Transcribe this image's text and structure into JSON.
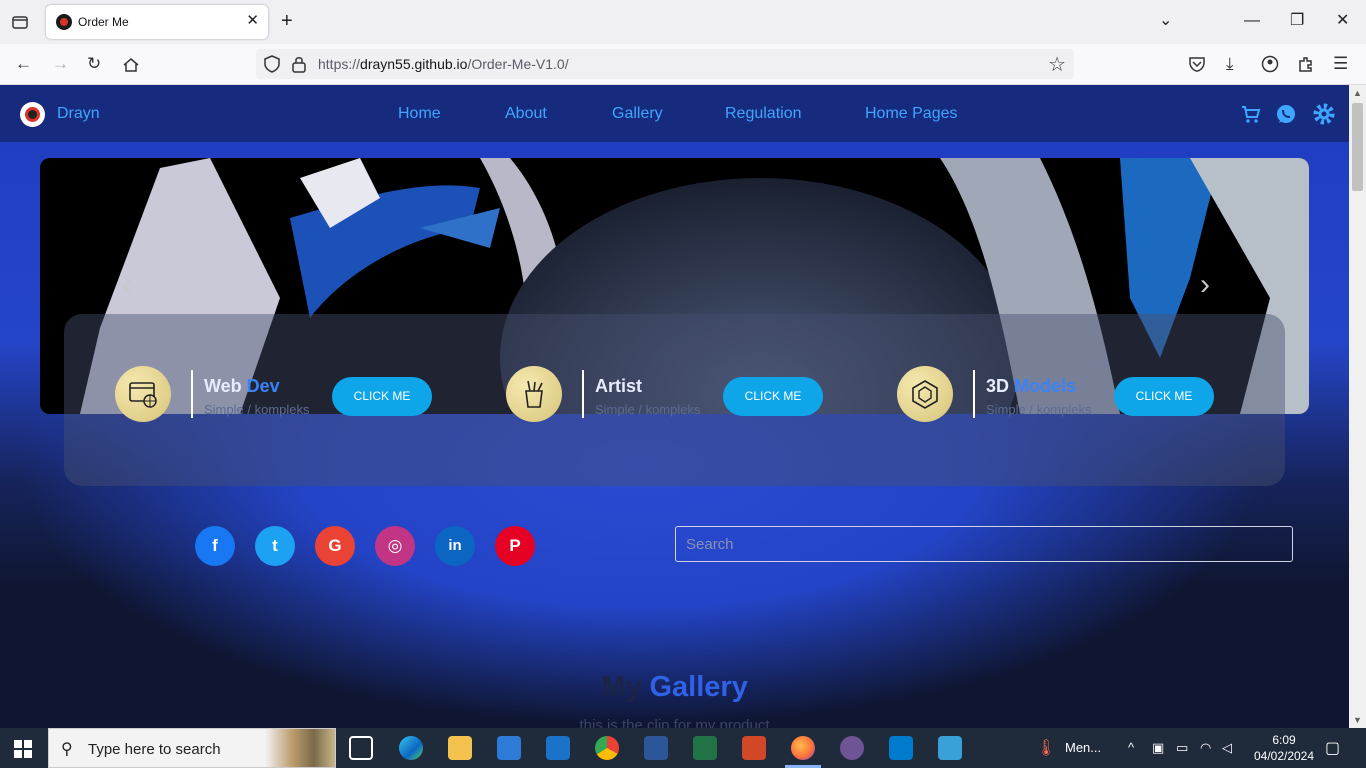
{
  "browser": {
    "tab_title": "Order Me",
    "url_prefix": "https://",
    "url_host": "drayn55.github.io",
    "url_path": "/Order-Me-V1.0/"
  },
  "site": {
    "brand": "Drayn",
    "menu": [
      "Home",
      "About",
      "Gallery",
      "Regulation",
      "Home Pages"
    ],
    "accent": "#3ea6ff"
  },
  "services": [
    {
      "name_a": "Web ",
      "name_b": "Dev",
      "sub": "Simple / kompleks",
      "button": "CLICK ME"
    },
    {
      "name_a": "Artist",
      "name_b": "",
      "sub": "Simple / kompleks",
      "button": "CLICK ME"
    },
    {
      "name_a": "3D ",
      "name_b": "Models",
      "sub": "Simple / kompleks",
      "button": "CLICK ME"
    }
  ],
  "social": [
    {
      "name": "facebook",
      "glyph": "f",
      "color": "#1877f2"
    },
    {
      "name": "twitter",
      "glyph": "t",
      "color": "#1da1f2"
    },
    {
      "name": "google",
      "glyph": "G",
      "color": "#ea4335"
    },
    {
      "name": "instagram",
      "glyph": "◎",
      "color": "#c13584"
    },
    {
      "name": "linkedin",
      "glyph": "in",
      "color": "#0a66c2"
    },
    {
      "name": "pinterest",
      "glyph": "P",
      "color": "#e60023"
    }
  ],
  "search": {
    "placeholder": "Search"
  },
  "gallery": {
    "title_a": "My ",
    "title_b": "Gallery",
    "subtitle": "this is the clip for my product"
  },
  "taskbar": {
    "search_placeholder": "Type here to search",
    "weather": "Men...",
    "time": "6:09",
    "date": "04/02/2024"
  }
}
